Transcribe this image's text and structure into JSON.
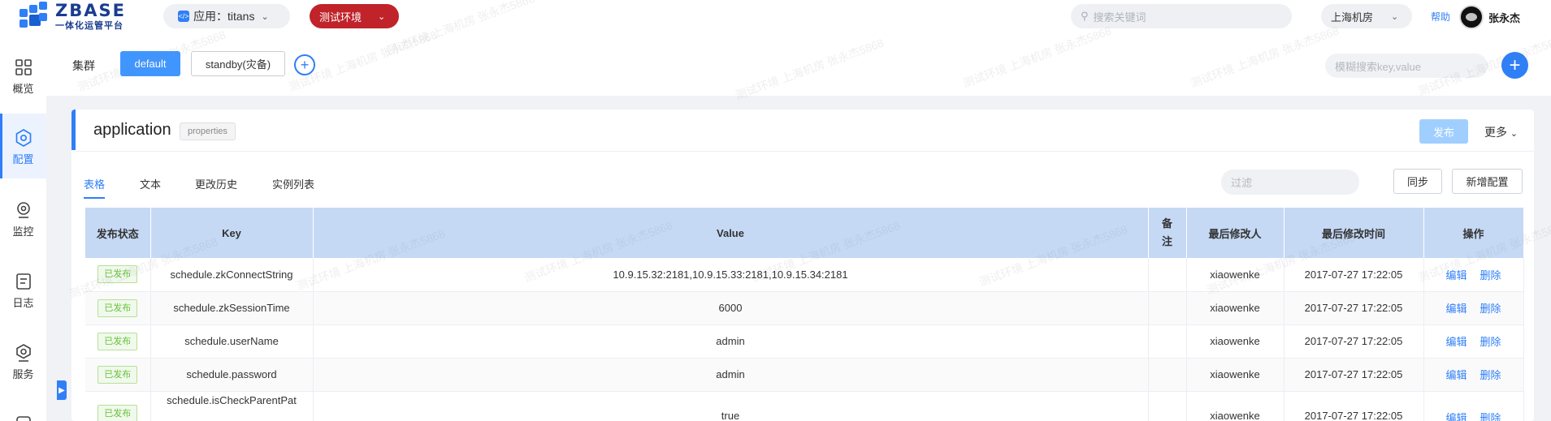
{
  "header": {
    "logo_title": "ZBASE",
    "logo_subtitle": "一体化运管平台",
    "app_selector": "应用：titans",
    "env_selector": "测试环境",
    "search_placeholder": "搜索关键词",
    "region_selector": "上海机房",
    "help": "帮助",
    "username": "张永杰"
  },
  "sidebar": {
    "items": [
      {
        "label": "概览",
        "icon": "overview-grid-icon"
      },
      {
        "label": "配置",
        "icon": "config-gear-icon",
        "active": true
      },
      {
        "label": "监控",
        "icon": "monitor-icon"
      },
      {
        "label": "日志",
        "icon": "log-icon"
      },
      {
        "label": "服务",
        "icon": "service-icon"
      }
    ]
  },
  "cluster_bar": {
    "label": "集群",
    "tabs": [
      "default",
      "standby(灾备)"
    ],
    "kv_search_placeholder": "模糊搜索key,value"
  },
  "card": {
    "title": "application",
    "badge": "properties",
    "publish": "发布",
    "more": "更多",
    "tabs": [
      "表格",
      "文本",
      "更改历史",
      "实例列表"
    ],
    "filter_placeholder": "过滤",
    "sync": "同步",
    "add_config": "新增配置"
  },
  "table": {
    "headers": [
      "发布状态",
      "Key",
      "Value",
      "备注",
      "最后修改人",
      "最后修改时间",
      "操作"
    ],
    "edit": "编辑",
    "delete": "删除",
    "rows": [
      {
        "status": "已发布",
        "key": "schedule.zkConnectString",
        "value": "10.9.15.32:2181,10.9.15.33:2181,10.9.15.34:2181",
        "note": "",
        "modifier": "xiaowenke",
        "time": "2017-07-27 17:22:05"
      },
      {
        "status": "已发布",
        "key": "schedule.zkSessionTime",
        "value": "6000",
        "note": "",
        "modifier": "xiaowenke",
        "time": "2017-07-27 17:22:05"
      },
      {
        "status": "已发布",
        "key": "schedule.userName",
        "value": "admin",
        "note": "",
        "modifier": "xiaowenke",
        "time": "2017-07-27 17:22:05"
      },
      {
        "status": "已发布",
        "key": "schedule.password",
        "value": "admin",
        "note": "",
        "modifier": "xiaowenke",
        "time": "2017-07-27 17:22:05"
      },
      {
        "status": "已发布",
        "key": "schedule.isCheckParentPat",
        "value": "true",
        "note": "",
        "modifier": "xiaowenke",
        "time": "2017-07-27 17:22:05"
      }
    ]
  },
  "watermark": "测试环境 上海机房 张永杰5868",
  "colors": {
    "accent": "#2f7ff7",
    "env": "#c0232a",
    "table_header": "#c5d9f5",
    "status_green": "#67c23a"
  }
}
